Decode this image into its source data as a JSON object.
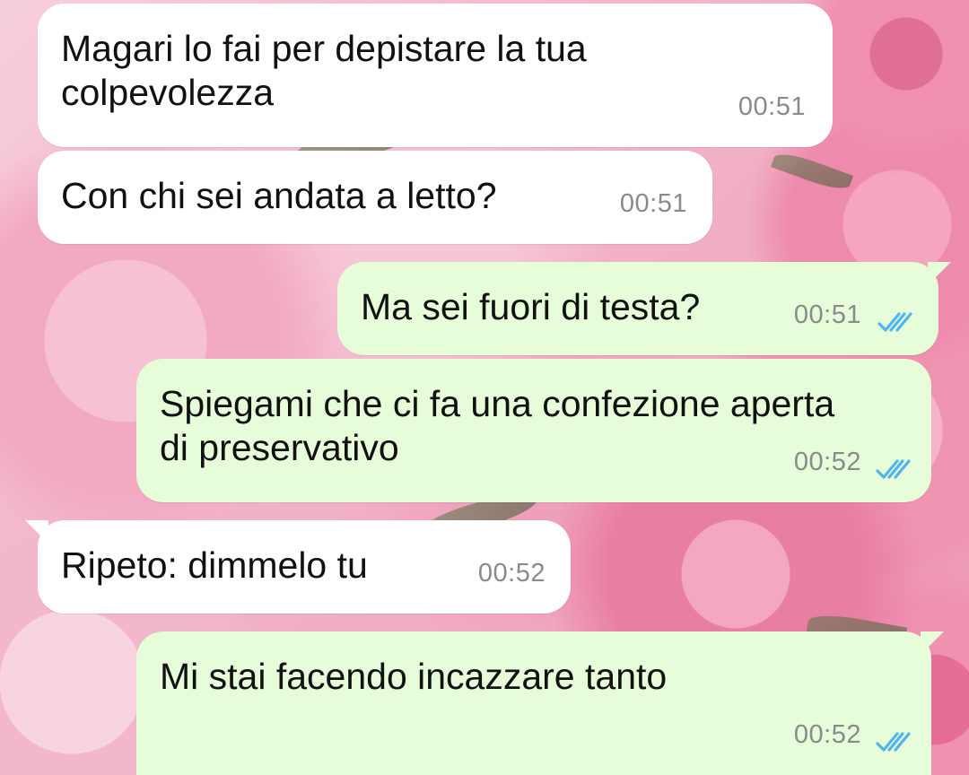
{
  "chat": {
    "messages": [
      {
        "direction": "incoming",
        "text": "Magari lo fai per depistare la tua colpevolezza",
        "time": "00:51"
      },
      {
        "direction": "incoming",
        "text": "Con chi sei andata a letto?",
        "time": "00:51"
      },
      {
        "direction": "outgoing",
        "text": "Ma sei fuori di testa?",
        "time": "00:51",
        "status": "read"
      },
      {
        "direction": "outgoing",
        "text": "Spiegami che ci fa una confezione aperta di preservativo",
        "time": "00:52",
        "status": "read"
      },
      {
        "direction": "incoming",
        "text": "Ripeto: dimmelo tu",
        "time": "00:52"
      },
      {
        "direction": "outgoing",
        "text": "Mi stai facendo incazzare tanto",
        "time": "00:52",
        "status": "read"
      }
    ]
  },
  "colors": {
    "incoming_bubble": "#ffffff",
    "outgoing_bubble": "#e7fcd9",
    "read_ticks": "#4fb6ec",
    "timestamp": "#8a8a8a"
  },
  "icons": {
    "read_receipt": "double-check-icon"
  }
}
